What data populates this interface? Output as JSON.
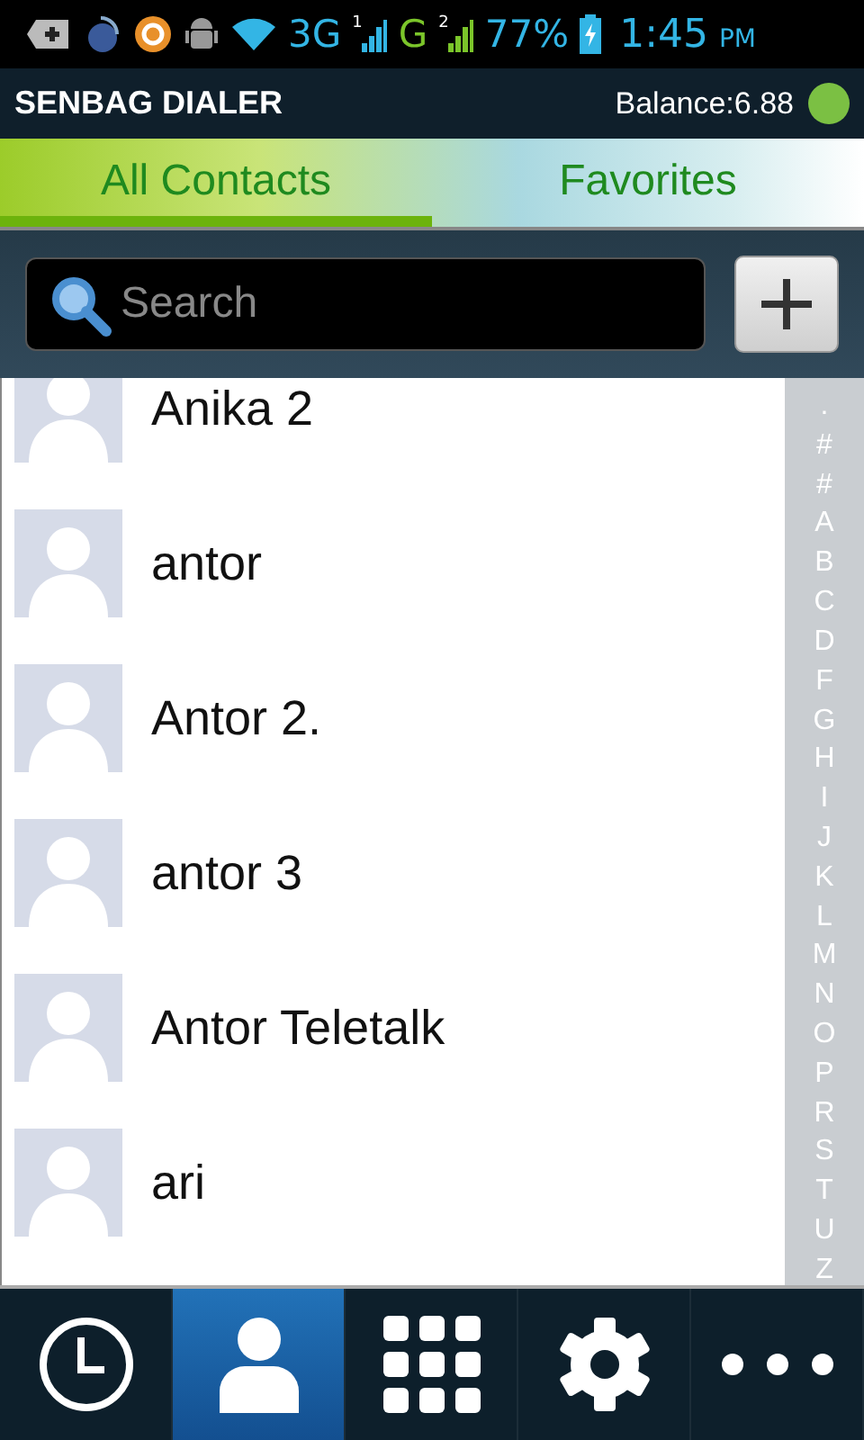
{
  "status_bar": {
    "network_3g": "3G",
    "sim_1": "1",
    "network_g": "G",
    "sim_2": "2",
    "battery": "77%",
    "time": "1:45",
    "ampm": "PM"
  },
  "app_bar": {
    "title": "SENBAG DIALER",
    "balance": "Balance:6.88",
    "online": true
  },
  "tabs": [
    {
      "label": "All Contacts",
      "selected": true
    },
    {
      "label": "Favorites",
      "selected": false
    }
  ],
  "search": {
    "placeholder": "Search"
  },
  "contacts": [
    {
      "name": "Anika 2"
    },
    {
      "name": "antor"
    },
    {
      "name": "Antor 2."
    },
    {
      "name": "antor 3"
    },
    {
      "name": "Antor Teletalk"
    },
    {
      "name": "ari"
    }
  ],
  "index": [
    ".",
    "#",
    "#",
    "A",
    "B",
    "C",
    "D",
    "F",
    "G",
    "H",
    "I",
    "J",
    "K",
    "L",
    "M",
    "N",
    "O",
    "P",
    "R",
    "S",
    "T",
    "U",
    "Z"
  ],
  "nav": [
    {
      "kind": "recent",
      "selected": false
    },
    {
      "kind": "contacts",
      "selected": true
    },
    {
      "kind": "dialpad",
      "selected": false
    },
    {
      "kind": "settings",
      "selected": false
    },
    {
      "kind": "more",
      "selected": false
    }
  ]
}
